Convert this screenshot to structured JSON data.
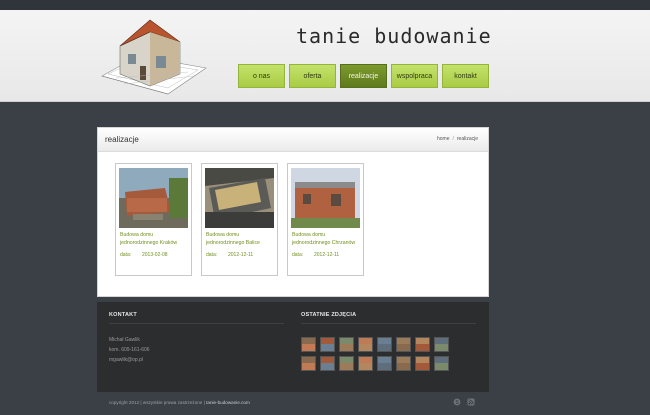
{
  "header": {
    "site_title": "tanie budowanie"
  },
  "nav": {
    "items": [
      {
        "label": "o nas"
      },
      {
        "label": "oferta"
      },
      {
        "label": "realizacje",
        "active": true
      },
      {
        "label": "wspolpraca"
      },
      {
        "label": "kontakt"
      }
    ]
  },
  "content": {
    "title": "realizacje",
    "breadcrumb": [
      "home",
      "realizacje"
    ],
    "cards": [
      {
        "title": "Budowa domu jednorodzinnego Kraków",
        "date_label": "data:",
        "date": "2013-02-08"
      },
      {
        "title": "Budowa domu jednorodzinnego Balice",
        "date_label": "data:",
        "date": "2012-12-11"
      },
      {
        "title": "Budowa domu jednorodzinnego Chrzanów",
        "date_label": "data:",
        "date": "2012-12-11"
      }
    ]
  },
  "footer": {
    "contact_title": "KONTAKT",
    "contact_name": "Michał Gawlik",
    "contact_phone": "kom. 609-161-606",
    "contact_email": "mgawlik@op.pl",
    "gallery_title": "OSTATNIE ZDJĘCIA",
    "gallery_count": 16
  },
  "bottom": {
    "copyright": "copyright 2012 | wszystkie prawa zastrzeżone |",
    "site_link": "tanie-budowanie.com",
    "social_icons": [
      "skype-icon",
      "rss-icon"
    ]
  },
  "colors": {
    "accent_green": "#a9cc44",
    "active_green": "#6b8a22",
    "page_bg": "#3a4046",
    "footer_bg": "#2c2d2f"
  }
}
